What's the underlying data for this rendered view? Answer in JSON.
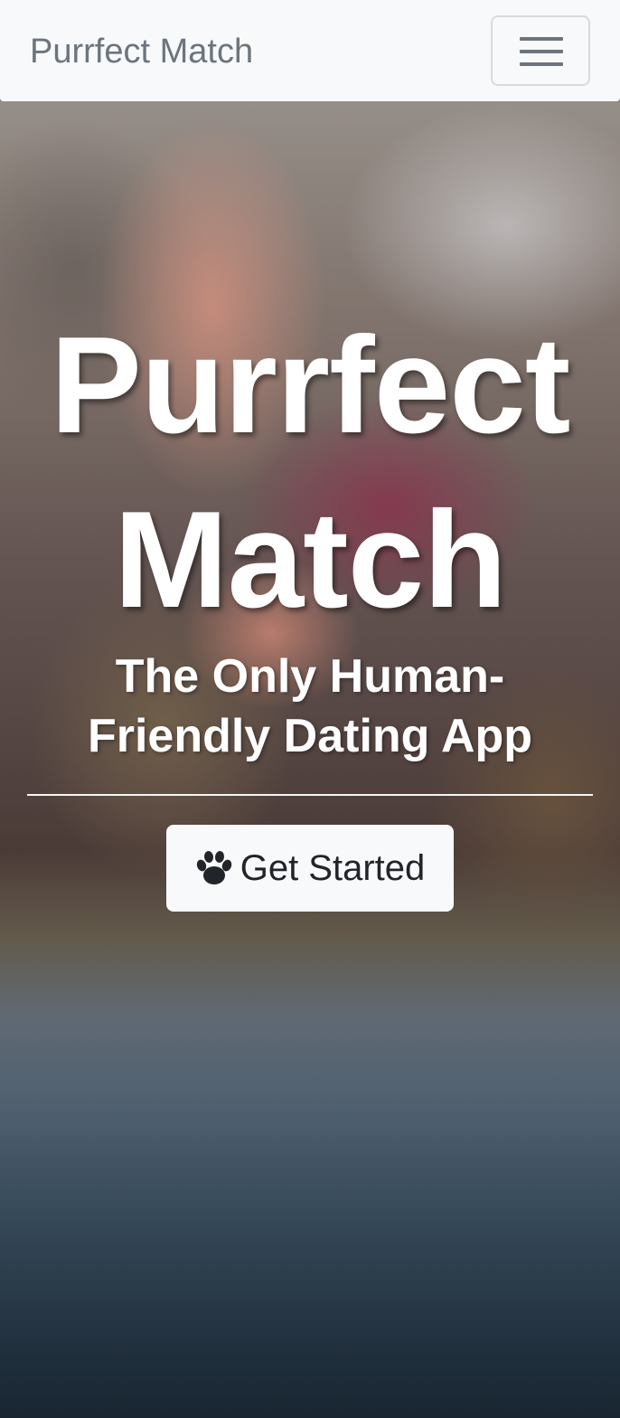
{
  "navbar": {
    "brand": "Purrfect Match",
    "toggler_icon": "hamburger-menu-icon",
    "background": "#f8f9fa"
  },
  "hero": {
    "title": "Purrfect Match",
    "subtitle": "The Only Human-Friendly Dating App",
    "cta": {
      "icon": "paw-icon",
      "label": "Get Started"
    }
  },
  "colors": {
    "text_on_hero": "#ffffff",
    "button_bg": "#f8f9fa",
    "button_text": "#212529",
    "muted": "#6c757d"
  }
}
